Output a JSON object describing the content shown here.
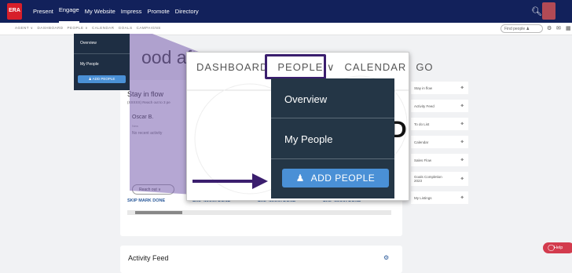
{
  "topbar": {
    "logo_text": "ERA",
    "nav": [
      "Present",
      "Engage",
      "My Website",
      "Impress",
      "Promote",
      "Directory"
    ],
    "active": "Engage"
  },
  "subbar": {
    "breadcrumbs": [
      "AGENT ∨",
      "DASHBOARD",
      "PEOPLE ∨",
      "CALENDAR",
      "GOALS",
      "CAMPAIGNS"
    ],
    "find_people": "Find people ♟"
  },
  "greeting": "ood aftern",
  "stay_in_flow": {
    "title": "Stay in flow",
    "subtitle": "(XXXXX) Reach out to 3 pe",
    "contact_name": "Oscar B.",
    "contact_status": "New",
    "no_recent": "No recent activity",
    "reach_out_label": "Reach out ∨",
    "actions": [
      "SKIP MARK DONE",
      "SKIP MARK DONE",
      "SKIP MARK DONE",
      "SKIP MARK DONE"
    ]
  },
  "activity_feed": {
    "title": "Activity Feed"
  },
  "widgets": [
    "Stay in flow",
    "Activity Feed",
    "To do List",
    "Calendar",
    "Sales Flow",
    "Goals Completion 2023",
    "My Listings"
  ],
  "help_label": "Help",
  "small_menu": {
    "items": [
      "Overview",
      "My People"
    ],
    "add_label": "ADD PEOPLE"
  },
  "zoom": {
    "nav": [
      "DASHBOARD",
      "PEOPLE ∨",
      "CALENDAR",
      "GO"
    ],
    "overview": "Overview",
    "my_people": "My People",
    "add_people": "ADD PEOPLE",
    "big_letter": "D"
  },
  "colors": {
    "topbar": "#12215b",
    "menu": "#243646",
    "accent": "#4a90d6",
    "highlight": "#3b1e6e"
  }
}
